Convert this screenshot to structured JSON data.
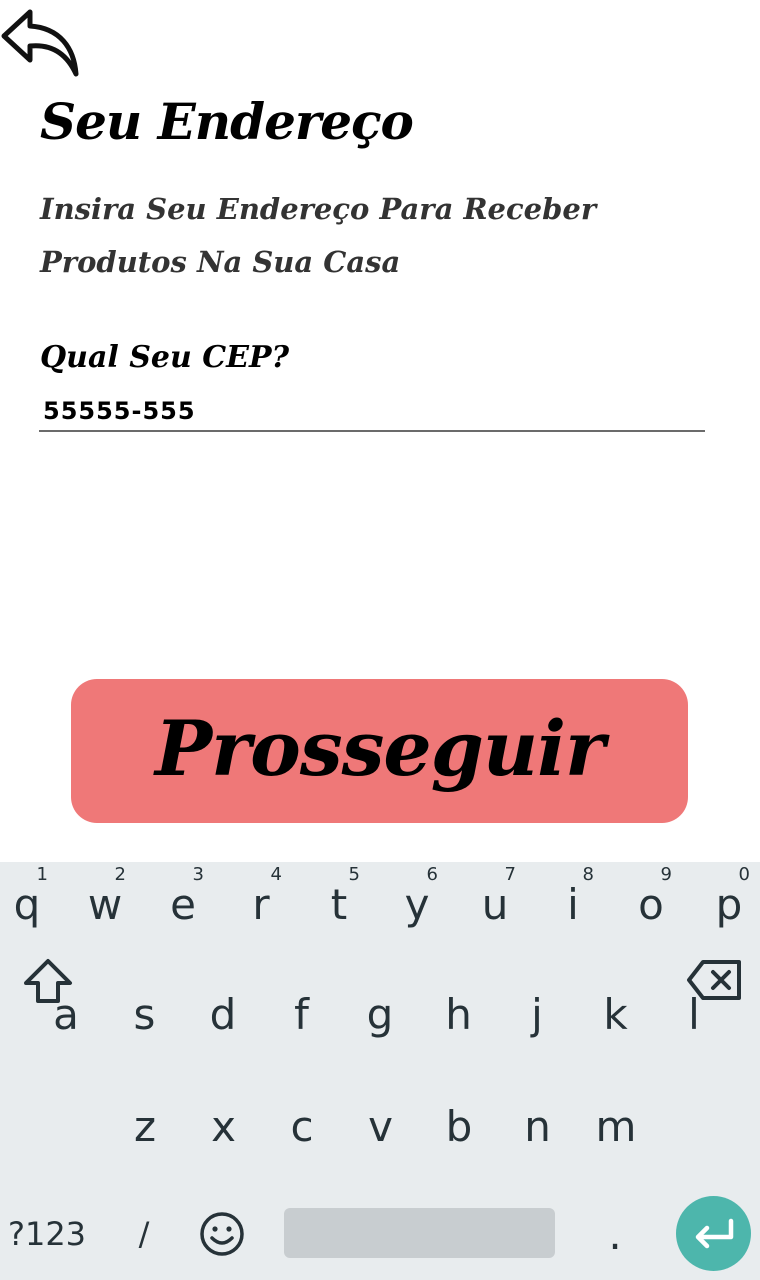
{
  "header": {
    "title": "Seu Endereço",
    "subtitle": "Insira Seu Endereço Para Receber Produtos Na Sua Casa"
  },
  "form": {
    "cep_label": "Qual Seu CEP?",
    "cep_value": "55555-555"
  },
  "actions": {
    "proceed_label": "Prosseguir"
  },
  "colors": {
    "button": "#ef7878",
    "keyboard_bg": "#e8ecee",
    "enter_key": "#4db6ac"
  },
  "keyboard": {
    "row1": [
      "q",
      "w",
      "e",
      "r",
      "t",
      "y",
      "u",
      "i",
      "o",
      "p"
    ],
    "row1_hints": [
      "1",
      "2",
      "3",
      "4",
      "5",
      "6",
      "7",
      "8",
      "9",
      "0"
    ],
    "row2": [
      "a",
      "s",
      "d",
      "f",
      "g",
      "h",
      "j",
      "k",
      "l"
    ],
    "row3": [
      "z",
      "x",
      "c",
      "v",
      "b",
      "n",
      "m"
    ],
    "symbols_key": "?123",
    "slash_key": "/",
    "period_key": ".",
    "icons": [
      "shift-icon",
      "backspace-icon",
      "emoji-icon",
      "enter-icon",
      "back-arrow-icon"
    ]
  }
}
